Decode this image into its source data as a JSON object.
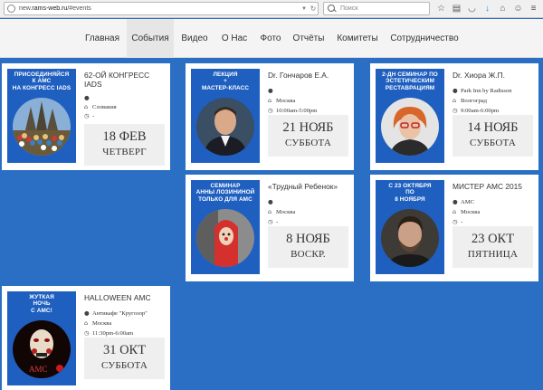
{
  "browser": {
    "url_prefix": "new.",
    "url_host": "rams-web.ru",
    "url_path": "/#events",
    "search_placeholder": "Поиск"
  },
  "nav": {
    "items": [
      {
        "label": "Главная"
      },
      {
        "label": "События"
      },
      {
        "label": "Видео"
      },
      {
        "label": "О Нас"
      },
      {
        "label": "Фото"
      },
      {
        "label": "Отчёты"
      },
      {
        "label": "Комитеты"
      },
      {
        "label": "Сотрудничество"
      }
    ]
  },
  "colors": {
    "accent": "#2a6fc4",
    "poster": "#1e5fc0"
  },
  "events": [
    {
      "poster_text": "ПРИСОЕДИНЯЙСЯ\nК АМС\nНА КОНГРЕСС IADS",
      "title": "62-ОЙ КОНГРЕСС IADS",
      "place": "",
      "city": "Словакия",
      "time": "-",
      "date": "18 ФЕВ",
      "weekday": "ЧЕТВЕРГ"
    },
    {
      "poster_text": "ЛЕКЦИЯ\n+\nМАСТЕР-КЛАСС",
      "title": "Dr. Гончаров Е.А.",
      "place": "",
      "city": "Москва",
      "time": "10:00am-5:00pm",
      "date": "21 НОЯБ",
      "weekday": "СУББОТА"
    },
    {
      "poster_text": "2-ДН СЕМИНАР ПО\nЭСТЕТИЧЕСКИМ\nРЕСТАВРАЦИЯМ",
      "title": "Dr. Хиора Ж.П.",
      "place": "Park Inn by Radisson",
      "city": "Волгоград",
      "time": "9:00am-6:00pm",
      "date": "14 НОЯБ",
      "weekday": "СУББОТА"
    },
    {
      "poster_text": "СЕМИНАР\nАННЫ ЛОЗИНИНОЙ\nТОЛЬКО ДЛЯ АМС",
      "title": "«Трудный Ребенок»",
      "place": "",
      "city": "Москва",
      "time": "-",
      "date": "8 НОЯБ",
      "weekday": "ВОСКР."
    },
    {
      "poster_text": "С 23 ОКТЯБРЯ\nПО\n8 НОЯБРЯ",
      "title": "МИСТЕР АМС 2015",
      "place": "АМС",
      "city": "Москва",
      "time": "-",
      "date": "23 ОКТ",
      "weekday": "ПЯТНИЦА"
    },
    {
      "poster_text": "ЖУТКАЯ\nНОЧЬ\nС АМС!",
      "title": "HALLOWEEN АМС",
      "place": "Антикафе \"Кругозор\"",
      "city": "Москва",
      "time": "11:30pm-6:00am",
      "date": "31 ОКТ",
      "weekday": "СУББОТА",
      "poster_logo": "АМС"
    }
  ]
}
